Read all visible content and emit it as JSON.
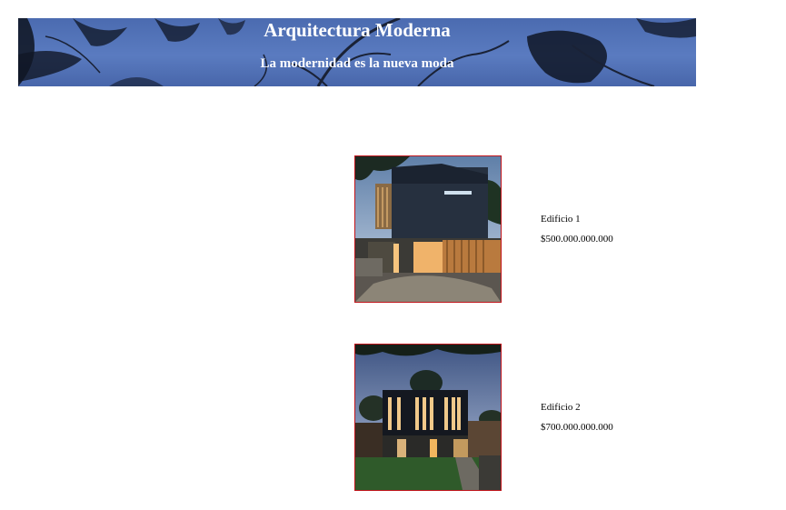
{
  "header": {
    "title": "Arquitectura Moderna",
    "subtitle": "La modernidad es la nueva moda",
    "background_image": "night-sky-with-tree-branches"
  },
  "listings": [
    {
      "name": "Edificio 1",
      "price": "$500.000.000.000",
      "image": "modern-house-dusk-photo"
    },
    {
      "name": "Edificio 2",
      "price": "$700.000.000.000",
      "image": "modern-house-night-photo"
    }
  ],
  "colors": {
    "image_border": "#c0141b",
    "banner_blue": "#4b6bb0",
    "text": "#000000"
  }
}
